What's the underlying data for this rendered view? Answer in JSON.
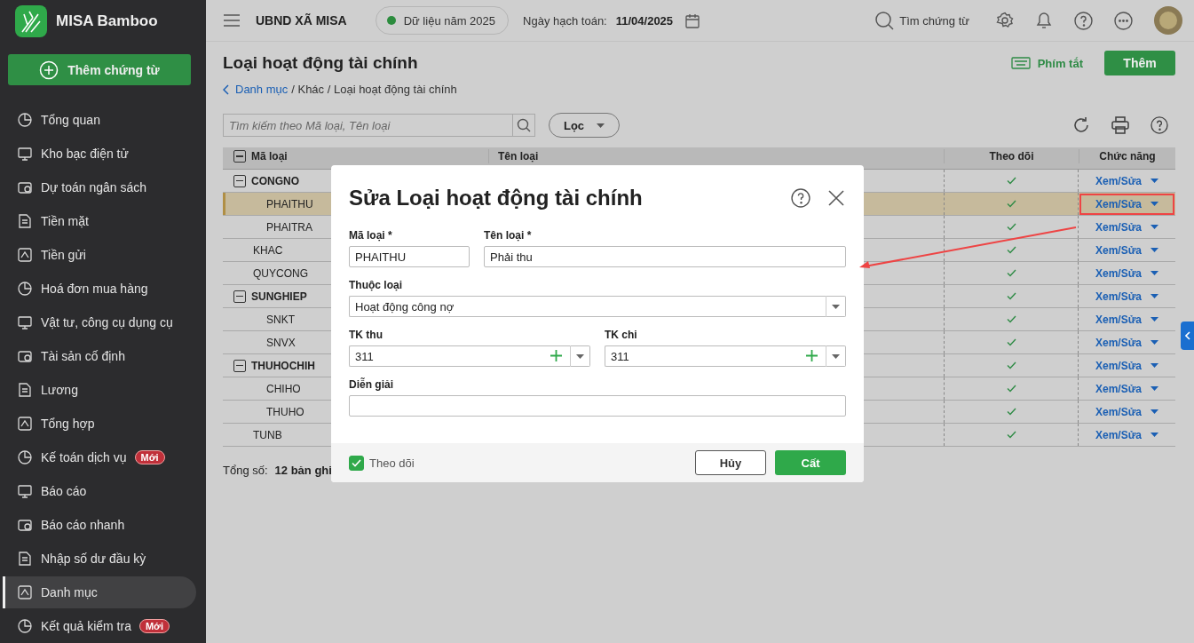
{
  "sidebar": {
    "logo": "MISA Bamboo",
    "add_button": "Thêm chứng từ",
    "items": [
      {
        "label": "Tổng quan",
        "selected": false
      },
      {
        "label": "Kho bạc điện tử",
        "selected": false
      },
      {
        "label": "Dự toán ngân sách",
        "selected": false
      },
      {
        "label": "Tiền mặt",
        "selected": false
      },
      {
        "label": "Tiền gửi",
        "selected": false
      },
      {
        "label": "Hoá đơn mua hàng",
        "selected": false
      },
      {
        "label": "Vật tư, công cụ dụng cụ",
        "selected": false
      },
      {
        "label": "Tài sản cố định",
        "selected": false
      },
      {
        "label": "Lương",
        "selected": false
      },
      {
        "label": "Tổng hợp",
        "selected": false
      },
      {
        "label": "Kế toán dịch vụ",
        "badge": "Mới",
        "selected": false
      },
      {
        "label": "Báo cáo",
        "selected": false
      },
      {
        "label": "Báo cáo nhanh",
        "selected": false
      },
      {
        "label": "Nhập số dư đầu kỳ",
        "selected": false
      },
      {
        "label": "Danh mục",
        "selected": true
      },
      {
        "label": "Kết quả kiểm tra",
        "badge": "Mới",
        "selected": false
      }
    ]
  },
  "header": {
    "org": "UBND XÃ MISA",
    "data_year": "Dữ liệu năm 2025",
    "date_label": "Ngày hạch toán:",
    "date": "11/04/2025",
    "search": "Tìm chứng từ"
  },
  "page": {
    "title": "Loại hoạt động tài chính",
    "breadcrumb": {
      "link": "Danh mục",
      "path": "/ Khác / Loại hoạt động tài chính"
    },
    "shortcuts": "Phím tắt",
    "add": "Thêm",
    "search": {
      "placeholder": "Tìm kiếm theo Mã loại, Tên loại"
    },
    "filter": "Lọc"
  },
  "table": {
    "columns": [
      "Mã loại",
      "Tên loại",
      "Theo dõi",
      "Chức năng"
    ],
    "rows": [
      {
        "code": "CONGNO",
        "expanded": true,
        "tracked": true,
        "action": "Xem/Sửa",
        "selected": false,
        "children": [
          {
            "code": "PHAITHU",
            "tracked": true,
            "action": "Xem/Sửa",
            "selected": true
          },
          {
            "code": "PHAITRA",
            "tracked": true,
            "action": "Xem/Sửa",
            "selected": false
          }
        ]
      },
      {
        "code": "KHAC",
        "tracked": true,
        "action": "Xem/Sửa",
        "selected": false
      },
      {
        "code": "QUYCONG",
        "tracked": true,
        "action": "Xem/Sửa",
        "selected": false
      },
      {
        "code": "SUNGHIEP",
        "expanded": true,
        "tracked": true,
        "action": "Xem/Sửa",
        "selected": false,
        "children": [
          {
            "code": "SNKT",
            "tracked": true,
            "action": "Xem/Sửa",
            "selected": false
          },
          {
            "code": "SNVX",
            "tracked": true,
            "action": "Xem/Sửa",
            "selected": false
          }
        ]
      },
      {
        "code": "THUHOCHIH",
        "expanded": true,
        "tracked": true,
        "action": "Xem/Sửa",
        "selected": false,
        "children": [
          {
            "code": "CHIHO",
            "tracked": true,
            "action": "Xem/Sửa",
            "selected": false
          },
          {
            "code": "THUHO",
            "tracked": true,
            "action": "Xem/Sửa",
            "selected": false
          }
        ]
      },
      {
        "code": "TUNB",
        "tracked": true,
        "action": "Xem/Sửa",
        "selected": false
      }
    ]
  },
  "footer": {
    "label": "Tổng số:",
    "count": "12 bản ghi"
  },
  "dialog": {
    "title": "Sửa Loại hoạt động tài chính",
    "code": {
      "label": "Mã loại *",
      "value": "PHAITHU"
    },
    "name": {
      "label": "Tên loại *",
      "value": "Phải thu"
    },
    "group": {
      "label": "Thuộc loại",
      "value": "Hoạt động công nợ"
    },
    "income_account": {
      "label": "TK thu",
      "value": "311"
    },
    "expense_account": {
      "label": "TK chi",
      "value": "311"
    },
    "description": {
      "label": "Diễn giải"
    },
    "tracked": {
      "label": "Theo dõi",
      "checked": true
    },
    "cancel": "Hủy",
    "save": "Cất"
  }
}
